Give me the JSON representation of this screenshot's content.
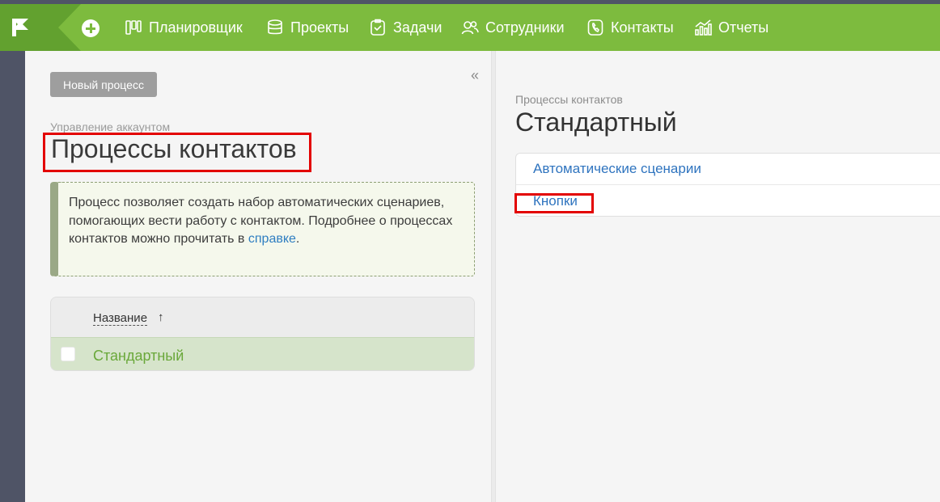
{
  "header": {
    "logo_icon": "flag-icon",
    "add_icon": "plus-circle-icon",
    "nav": [
      {
        "label": "Планировщик",
        "icon": "planner-icon"
      },
      {
        "label": "Проекты",
        "icon": "database-icon"
      },
      {
        "label": "Задачи",
        "icon": "clipboard-check-icon"
      },
      {
        "label": "Сотрудники",
        "icon": "users-icon"
      },
      {
        "label": "Контакты",
        "icon": "phone-icon"
      },
      {
        "label": "Отчеты",
        "icon": "chart-icon"
      }
    ],
    "colors": {
      "bar": "#7dbb3e",
      "logo_bg": "#62a12f",
      "rail": "#4f5466"
    }
  },
  "left": {
    "new_button": "Новый процесс",
    "collapse": "«",
    "breadcrumb": "Управление аккаунтом",
    "title": "Процессы контактов",
    "info": {
      "text": "Процесс позволяет создать набор автоматических сценариев, помогающих вести работу с контактом. Подробнее о процессах контактов можно прочитать в ",
      "link": "справке",
      "end": "."
    },
    "table": {
      "column": "Название",
      "sort": "↑",
      "rows": [
        {
          "name": "Стандартный"
        }
      ]
    }
  },
  "right": {
    "breadcrumb": "Процессы контактов",
    "title": "Стандартный",
    "menu": [
      {
        "label": "Автоматические сценарии"
      },
      {
        "label": "Кнопки"
      }
    ]
  },
  "highlight_color": "#e30000"
}
